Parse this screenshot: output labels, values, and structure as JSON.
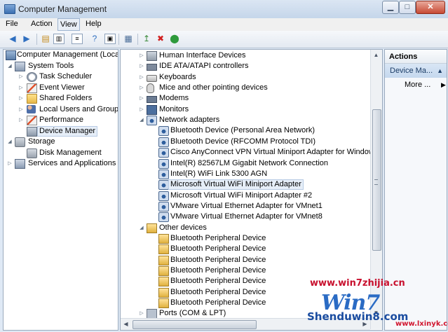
{
  "window": {
    "title": "Computer Management"
  },
  "menu": [
    "File",
    "Action",
    "View",
    "Help"
  ],
  "left_tree": [
    {
      "label": "Computer Management (Local)",
      "icon": "computer-icon",
      "expander": ""
    },
    {
      "label": "System Tools",
      "icon": "tools-icon",
      "expander": "expanded"
    },
    {
      "label": "Task Scheduler",
      "icon": "clock-icon",
      "expander": "collapsed"
    },
    {
      "label": "Event Viewer",
      "icon": "event-viewer-icon",
      "expander": "collapsed"
    },
    {
      "label": "Shared Folders",
      "icon": "folder-icon",
      "expander": "collapsed"
    },
    {
      "label": "Local Users and Groups",
      "icon": "users-icon",
      "expander": "collapsed"
    },
    {
      "label": "Performance",
      "icon": "performance-icon",
      "expander": "collapsed"
    },
    {
      "label": "Device Manager",
      "icon": "device-manager-icon",
      "expander": "",
      "selected": true
    },
    {
      "label": "Storage",
      "icon": "storage-icon",
      "expander": "expanded"
    },
    {
      "label": "Disk Management",
      "icon": "disk-icon",
      "expander": ""
    },
    {
      "label": "Services and Applications",
      "icon": "services-icon",
      "expander": "collapsed"
    }
  ],
  "device_tree": [
    {
      "label": "Human Interface Devices",
      "icon": "hid-icon",
      "expander": "collapsed"
    },
    {
      "label": "IDE ATA/ATAPI controllers",
      "icon": "ide-icon",
      "expander": "collapsed"
    },
    {
      "label": "Keyboards",
      "icon": "keyboard-icon",
      "expander": "collapsed"
    },
    {
      "label": "Mice and other pointing devices",
      "icon": "mouse-icon",
      "expander": "collapsed"
    },
    {
      "label": "Modems",
      "icon": "modem-icon",
      "expander": "collapsed"
    },
    {
      "label": "Monitors",
      "icon": "monitor-icon",
      "expander": "collapsed"
    },
    {
      "label": "Network adapters",
      "icon": "network-icon",
      "expander": "expanded"
    },
    {
      "label": "Bluetooth Device (Personal Area Network)",
      "icon": "network-adapter-icon",
      "expander": ""
    },
    {
      "label": "Bluetooth Device (RFCOMM Protocol TDI)",
      "icon": "network-adapter-icon",
      "expander": ""
    },
    {
      "label": "Cisco AnyConnect VPN Virtual Miniport Adapter for Windows",
      "icon": "network-adapter-icon",
      "expander": ""
    },
    {
      "label": "Intel(R) 82567LM Gigabit Network Connection",
      "icon": "network-adapter-icon",
      "expander": ""
    },
    {
      "label": "Intel(R) WiFi Link 5300 AGN",
      "icon": "network-adapter-icon",
      "expander": ""
    },
    {
      "label": "Microsoft Virtual WiFi Miniport Adapter",
      "icon": "network-adapter-icon",
      "expander": "",
      "selected": true
    },
    {
      "label": "Microsoft Virtual WiFi Miniport Adapter #2",
      "icon": "network-adapter-icon",
      "expander": ""
    },
    {
      "label": "VMware Virtual Ethernet Adapter for VMnet1",
      "icon": "network-adapter-icon",
      "expander": ""
    },
    {
      "label": "VMware Virtual Ethernet Adapter for VMnet8",
      "icon": "network-adapter-icon",
      "expander": ""
    },
    {
      "label": "Other devices",
      "icon": "other-devices-icon",
      "expander": "expanded"
    },
    {
      "label": "Bluetooth Peripheral Device",
      "icon": "warning-device-icon",
      "expander": ""
    },
    {
      "label": "Bluetooth Peripheral Device",
      "icon": "warning-device-icon",
      "expander": ""
    },
    {
      "label": "Bluetooth Peripheral Device",
      "icon": "warning-device-icon",
      "expander": ""
    },
    {
      "label": "Bluetooth Peripheral Device",
      "icon": "warning-device-icon",
      "expander": ""
    },
    {
      "label": "Bluetooth Peripheral Device",
      "icon": "warning-device-icon",
      "expander": ""
    },
    {
      "label": "Bluetooth Peripheral Device",
      "icon": "warning-device-icon",
      "expander": ""
    },
    {
      "label": "Bluetooth Peripheral Device",
      "icon": "warning-device-icon",
      "expander": ""
    },
    {
      "label": "Ports (COM & LPT)",
      "icon": "ports-icon",
      "expander": "collapsed"
    }
  ],
  "actions": {
    "header": "Actions",
    "selected": "Device Ma...",
    "more": "More ..."
  },
  "watermark": {
    "url": "www.win7zhijia.cn",
    "logo": "Win7",
    "brand": "Shenduwin8.com",
    "site": "www.lxinyk.com"
  },
  "colors": {
    "window_bg": "#dfe9f5",
    "selection": "#e6eef8",
    "actions_selected": "#c5d8ee",
    "watermark_red": "#c8102e",
    "watermark_blue": "#1a4ca0"
  }
}
